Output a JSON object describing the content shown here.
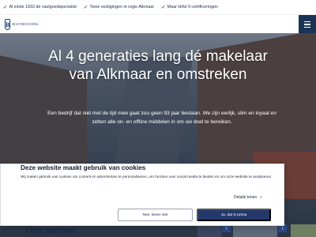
{
  "topbar": {
    "usps": [
      "Al sinds 1933 dé vastgoedspecialist",
      "Twee vestigingen in regio Alkmaar",
      "Maar liefst 9 certificeringen"
    ]
  },
  "header": {
    "logo_text": "ROOTHOUDERS"
  },
  "hero": {
    "title_line1": "Al 4 generaties lang dé makelaar",
    "title_line2": "van Alkmaar en omstreken",
    "text": "Een bedrijf dat niet met de tijd mee gaat zou geen 93 jaar bestaan. We zijn eerlijk, slim en loyaal en zetten alle on- en offline middelen in om uw doel te bereiken."
  },
  "cookie": {
    "title": "Deze website maakt gebruik van cookies",
    "text": "Wij maken gebruik van cookies om content en advertenties te personaliseren, om functies voor social media te bieden en om onze website te analyseren.",
    "details_label": "Details tonen",
    "reject_label": "Nee, liever niet",
    "accept_label": "Ja, dat is prima"
  },
  "aanbod": {
    "title": "Ons aanbod"
  },
  "colors": {
    "navy": "#1b3354",
    "accent_blue": "#24386b",
    "check_green": "#2e8b57"
  },
  "icons": [
    "check-icon",
    "hamburger-menu-icon",
    "chevron-right-icon",
    "arrow-left-icon",
    "arrow-right-icon"
  ]
}
